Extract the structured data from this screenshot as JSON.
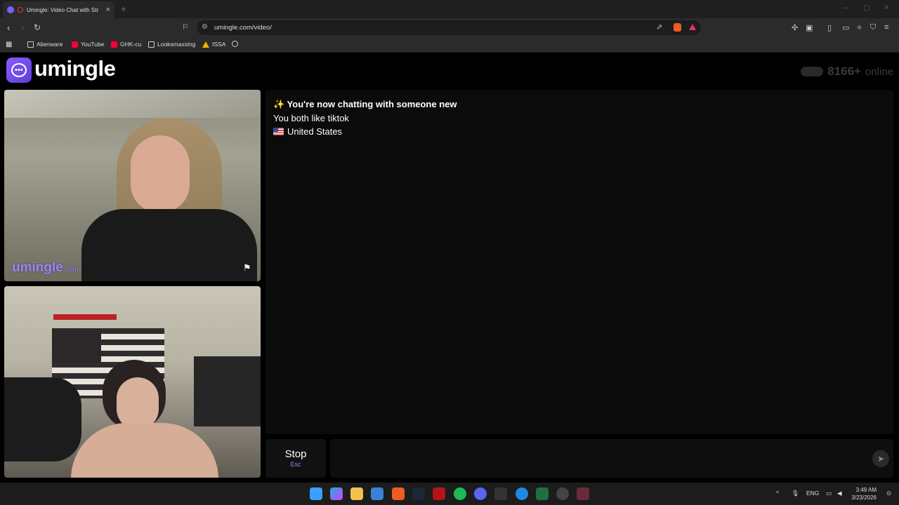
{
  "browser": {
    "tab_title": "Umingle: Video Chat with Str",
    "url": "umingle.com/video/",
    "new_tab": "+",
    "bookmarks": [
      "Alienware",
      "YouTube",
      "GHK-cu",
      "Looksmaxxing",
      "ISSA"
    ]
  },
  "site": {
    "logo": "umingle",
    "online_count": "8166+",
    "online_label": "online",
    "watermark_main": "umingle",
    "watermark_suffix": ".com"
  },
  "chat": {
    "intro": "✨ You're now chatting with someone new",
    "common_interest": "You both like tiktok",
    "country": "United States"
  },
  "controls": {
    "stop_label": "Stop",
    "stop_shortcut": "Esc",
    "message_placeholder": ""
  },
  "taskbar": {
    "language": "ENG",
    "time": "3:49 AM",
    "date": "3/23/2026"
  },
  "colors": {
    "brand": "#7b5cff",
    "page_background": "#000000",
    "chat_background": "#0b0b0b"
  }
}
